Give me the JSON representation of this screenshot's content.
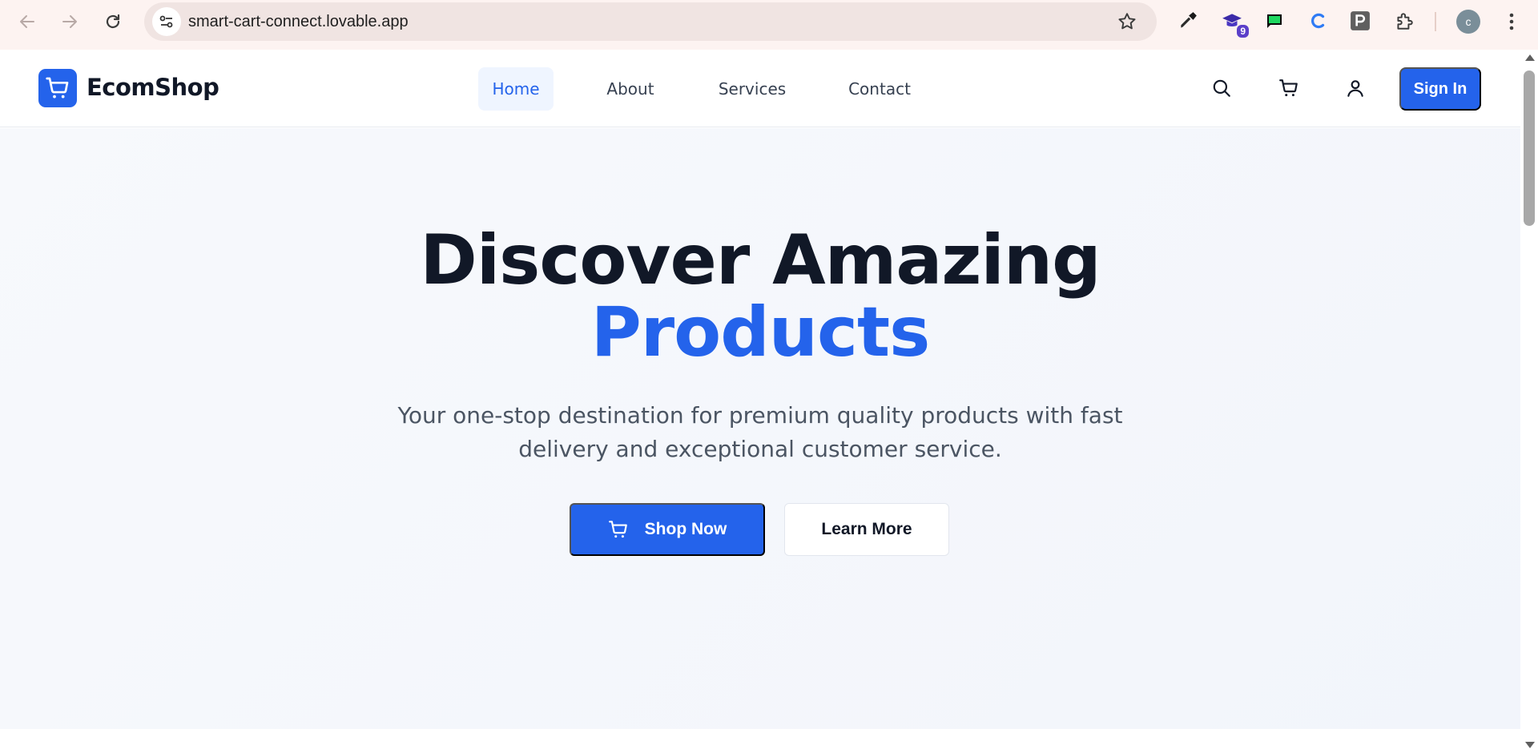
{
  "browser": {
    "url": "smart-cart-connect.lovable.app",
    "extension_badge": "9",
    "profile_initial": "c"
  },
  "site": {
    "logo_text": "EcomShop",
    "nav": [
      {
        "label": "Home",
        "active": true
      },
      {
        "label": "About",
        "active": false
      },
      {
        "label": "Services",
        "active": false
      },
      {
        "label": "Contact",
        "active": false
      }
    ],
    "sign_in_label": "Sign In"
  },
  "hero": {
    "title_line1": "Discover Amazing",
    "title_line2": "Products",
    "subtitle": "Your one-stop destination for premium quality products with fast delivery and exceptional customer service.",
    "primary_button": "Shop Now",
    "secondary_button": "Learn More"
  },
  "colors": {
    "brand": "#2463eb",
    "heading": "#111827",
    "body_text": "#4b5563"
  },
  "icons": [
    "back-arrow-icon",
    "forward-arrow-icon",
    "reload-icon",
    "site-info-icon",
    "bookmark-star-icon",
    "eyedropper-icon",
    "graduation-cap-icon",
    "chat-flag-icon",
    "c-logo-icon",
    "p-logo-icon",
    "puzzle-icon",
    "search-icon",
    "cart-icon",
    "user-icon"
  ]
}
